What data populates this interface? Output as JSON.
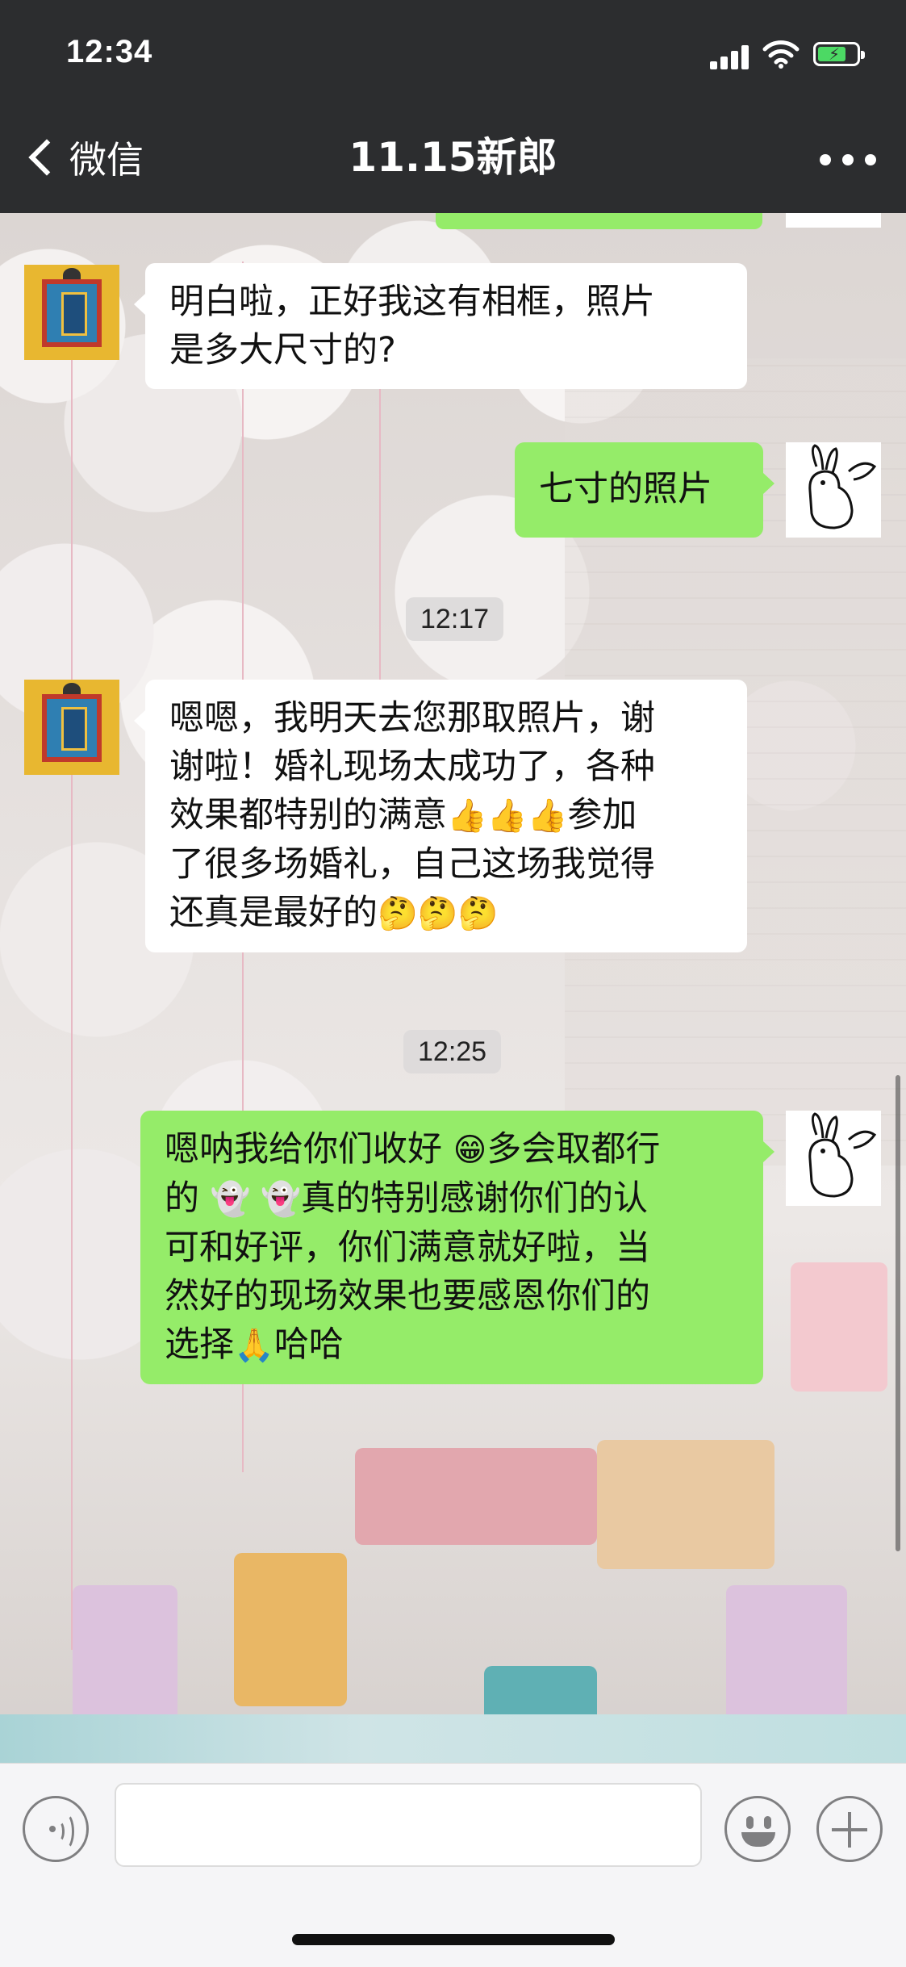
{
  "status_bar": {
    "time": "12:34"
  },
  "nav": {
    "back_label": "微信",
    "title": "11.15新郎"
  },
  "messages": [
    {
      "side": "left",
      "text_line1": "明白啦，正好我这有相框，照片",
      "text_line2": "是多大尺寸的?"
    },
    {
      "side": "right",
      "text": "七寸的照片"
    },
    {
      "side": "left",
      "line1": "嗯嗯，我明天去您那取照片，谢",
      "line2": "谢啦！婚礼现场太成功了，各种",
      "line3a": "效果都特别的满意",
      "line3_emoji": "👍👍👍",
      "line3b": "参加",
      "line4": "了很多场婚礼，自己这场我觉得",
      "line5a": "还真是最好的",
      "line5_emoji": "🤔🤔🤔"
    },
    {
      "side": "right",
      "line1a": "嗯呐我给你们收好 ",
      "line1_emoji": "😁",
      "line1b": "多会取都行",
      "line2a": "的 ",
      "line2_emoji": "👻 👻",
      "line2b": "真的特别感谢你们的认",
      "line3": "可和好评，你们满意就好啦，当",
      "line4": "然好的现场效果也要感恩你们的",
      "line5a": "选择",
      "line5_emoji": "🙏",
      "line5b": "哈哈"
    }
  ],
  "timestamps": {
    "t1": "12:17",
    "t2": "12:25"
  },
  "input_bar": {
    "placeholder": ""
  },
  "icons": {
    "voice": "voice-icon",
    "emoji": "emoji-icon",
    "plus": "plus-icon",
    "back": "chevron-left-icon",
    "more": "more-icon"
  },
  "colors": {
    "green_bubble": "#95ec69",
    "nav_bg": "#2c2d2f"
  }
}
